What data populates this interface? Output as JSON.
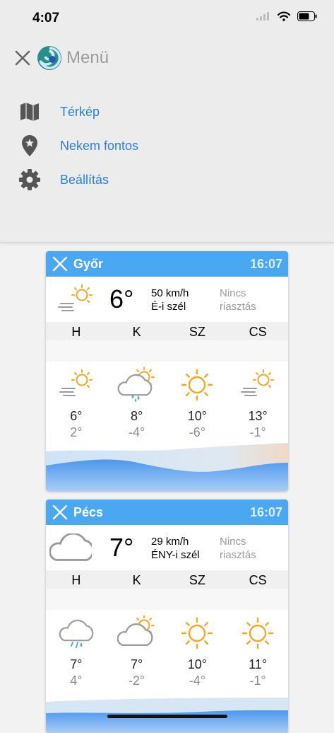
{
  "status": {
    "time": "4:07"
  },
  "menu": {
    "title": "Menü",
    "items": [
      {
        "label": "Térkép",
        "icon": "map-icon"
      },
      {
        "label": "Nekem fontos",
        "icon": "location-star-icon"
      },
      {
        "label": "Beállítás",
        "icon": "gear-icon"
      }
    ]
  },
  "cards": [
    {
      "city": "Győr",
      "updated": "16:07",
      "current": {
        "temp": "6°",
        "wind_speed": "50 km/h",
        "wind_dir": "É-i szél",
        "alert_line1": "Nincs",
        "alert_line2": "riasztás",
        "icon": "sun-wind-icon"
      },
      "days": [
        "H",
        "K",
        "SZ",
        "CS"
      ],
      "forecast": [
        {
          "max": "6°",
          "min": "2°",
          "icon": "sun-wind-icon"
        },
        {
          "max": "8°",
          "min": "-4°",
          "icon": "rain-cloud-sun-icon"
        },
        {
          "max": "10°",
          "min": "-6°",
          "icon": "sun-icon"
        },
        {
          "max": "13°",
          "min": "-1°",
          "icon": "sun-wind-icon"
        }
      ]
    },
    {
      "city": "Pécs",
      "updated": "16:07",
      "current": {
        "temp": "7°",
        "wind_speed": "29 km/h",
        "wind_dir": "ÉNY-i szél",
        "alert_line1": "Nincs",
        "alert_line2": "riasztás",
        "icon": "cloud-icon"
      },
      "days": [
        "H",
        "K",
        "SZ",
        "CS"
      ],
      "forecast": [
        {
          "max": "7°",
          "min": "4°",
          "icon": "rain-cloud-icon"
        },
        {
          "max": "7°",
          "min": "-2°",
          "icon": "cloud-sun-icon"
        },
        {
          "max": "10°",
          "min": "-4°",
          "icon": "sun-icon"
        },
        {
          "max": "11°",
          "min": "-1°",
          "icon": "sun-icon"
        }
      ]
    }
  ],
  "colors": {
    "accent": "#4aa7f2",
    "link": "#2b7fd8",
    "sun": "#f5a623"
  }
}
